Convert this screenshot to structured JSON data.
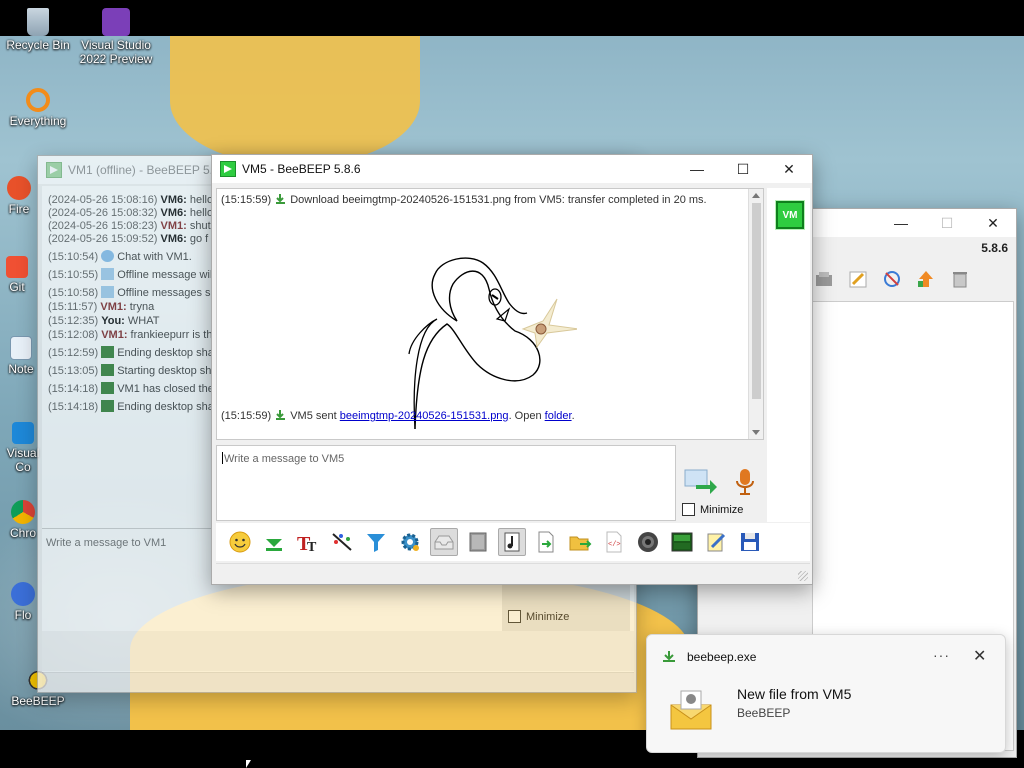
{
  "desktop": {
    "icons": [
      {
        "label": "Recycle Bin"
      },
      {
        "label": "Visual Studio 2022 Preview"
      },
      {
        "label": "Everything"
      },
      {
        "label": "Fire"
      },
      {
        "label": "Git"
      },
      {
        "label": "Note"
      },
      {
        "label": "Visual Co"
      },
      {
        "label": "Chro"
      },
      {
        "label": "Flo"
      },
      {
        "label": "BeeBEEP"
      }
    ]
  },
  "vm1_window": {
    "title": "VM1 (offline) - BeeBEEP 5.8",
    "lines": [
      {
        "ts": "(2024-05-26 15:08:16)",
        "user": "VM6:",
        "text": " hello"
      },
      {
        "ts": "(2024-05-26 15:08:32)",
        "user": "VM6:",
        "text": " hello"
      },
      {
        "ts": "(2024-05-26 15:08:23)",
        "user": "VM1:",
        "text": " shut"
      },
      {
        "ts": "(2024-05-26 15:09:52)",
        "user": "VM6:",
        "text": " go f"
      },
      {
        "ts": "(15:10:54)",
        "user": "",
        "text": "Chat with VM1."
      },
      {
        "ts": "(15:10:55)",
        "user": "",
        "text": "Offline message wil"
      },
      {
        "ts": "(15:10:58)",
        "user": "",
        "text": "Offline messages se"
      },
      {
        "ts": "(15:11:57)",
        "user": "VM1:",
        "text": " tryna"
      },
      {
        "ts": "(15:12:35)",
        "user": "You:",
        "text": " WHAT"
      },
      {
        "ts": "(15:12:08)",
        "user": "VM1:",
        "text": " frankieepurr is th"
      },
      {
        "ts": "(15:12:59)",
        "user": "",
        "text": "Ending desktop sha"
      },
      {
        "ts": "(15:13:05)",
        "user": "",
        "text": "Starting desktop sh"
      },
      {
        "ts": "(15:14:18)",
        "user": "",
        "text": "VM1 has closed the"
      },
      {
        "ts": "(15:14:18)",
        "user": "",
        "text": "Ending desktop sha"
      }
    ],
    "input_placeholder": "Write a message to VM1",
    "minimize_label": "Minimize"
  },
  "right_window": {
    "version": "5.8.6"
  },
  "vm5_window": {
    "title": "VM5 - BeeBEEP 5.8.6",
    "avatar_label": "VM",
    "messages": {
      "download": {
        "ts": "(15:15:59)",
        "text": "Download beeimgtmp-20240526-151531.png from VM5: transfer completed in 20 ms."
      },
      "sent": {
        "ts": "(15:15:59)",
        "prefix": "VM5 sent ",
        "file_link": "beeimgtmp-20240526-151531.png",
        "middle": ". Open ",
        "folder_link": "folder",
        "suffix": "."
      }
    },
    "input_placeholder": "Write a message to VM5",
    "minimize_label": "Minimize",
    "toolbar": [
      {
        "name": "emoticons"
      },
      {
        "name": "send-file"
      },
      {
        "name": "font"
      },
      {
        "name": "font-color"
      },
      {
        "name": "filter"
      },
      {
        "name": "settings"
      },
      {
        "name": "save-chat"
      },
      {
        "name": "spell"
      },
      {
        "name": "compact"
      },
      {
        "name": "markdown"
      },
      {
        "name": "share-file"
      },
      {
        "name": "share-folder"
      },
      {
        "name": "html"
      },
      {
        "name": "screenshot"
      },
      {
        "name": "desktop-share"
      },
      {
        "name": "edit-group"
      },
      {
        "name": "save-window"
      }
    ]
  },
  "toast": {
    "app": "beebeep.exe",
    "more": "···",
    "title": "New file from VM5",
    "subtitle": "BeeBEEP"
  },
  "colors": {
    "beebeep_green": "#2ecc40",
    "link": "#0000cc",
    "vm1_red": "#7a1a1a"
  }
}
